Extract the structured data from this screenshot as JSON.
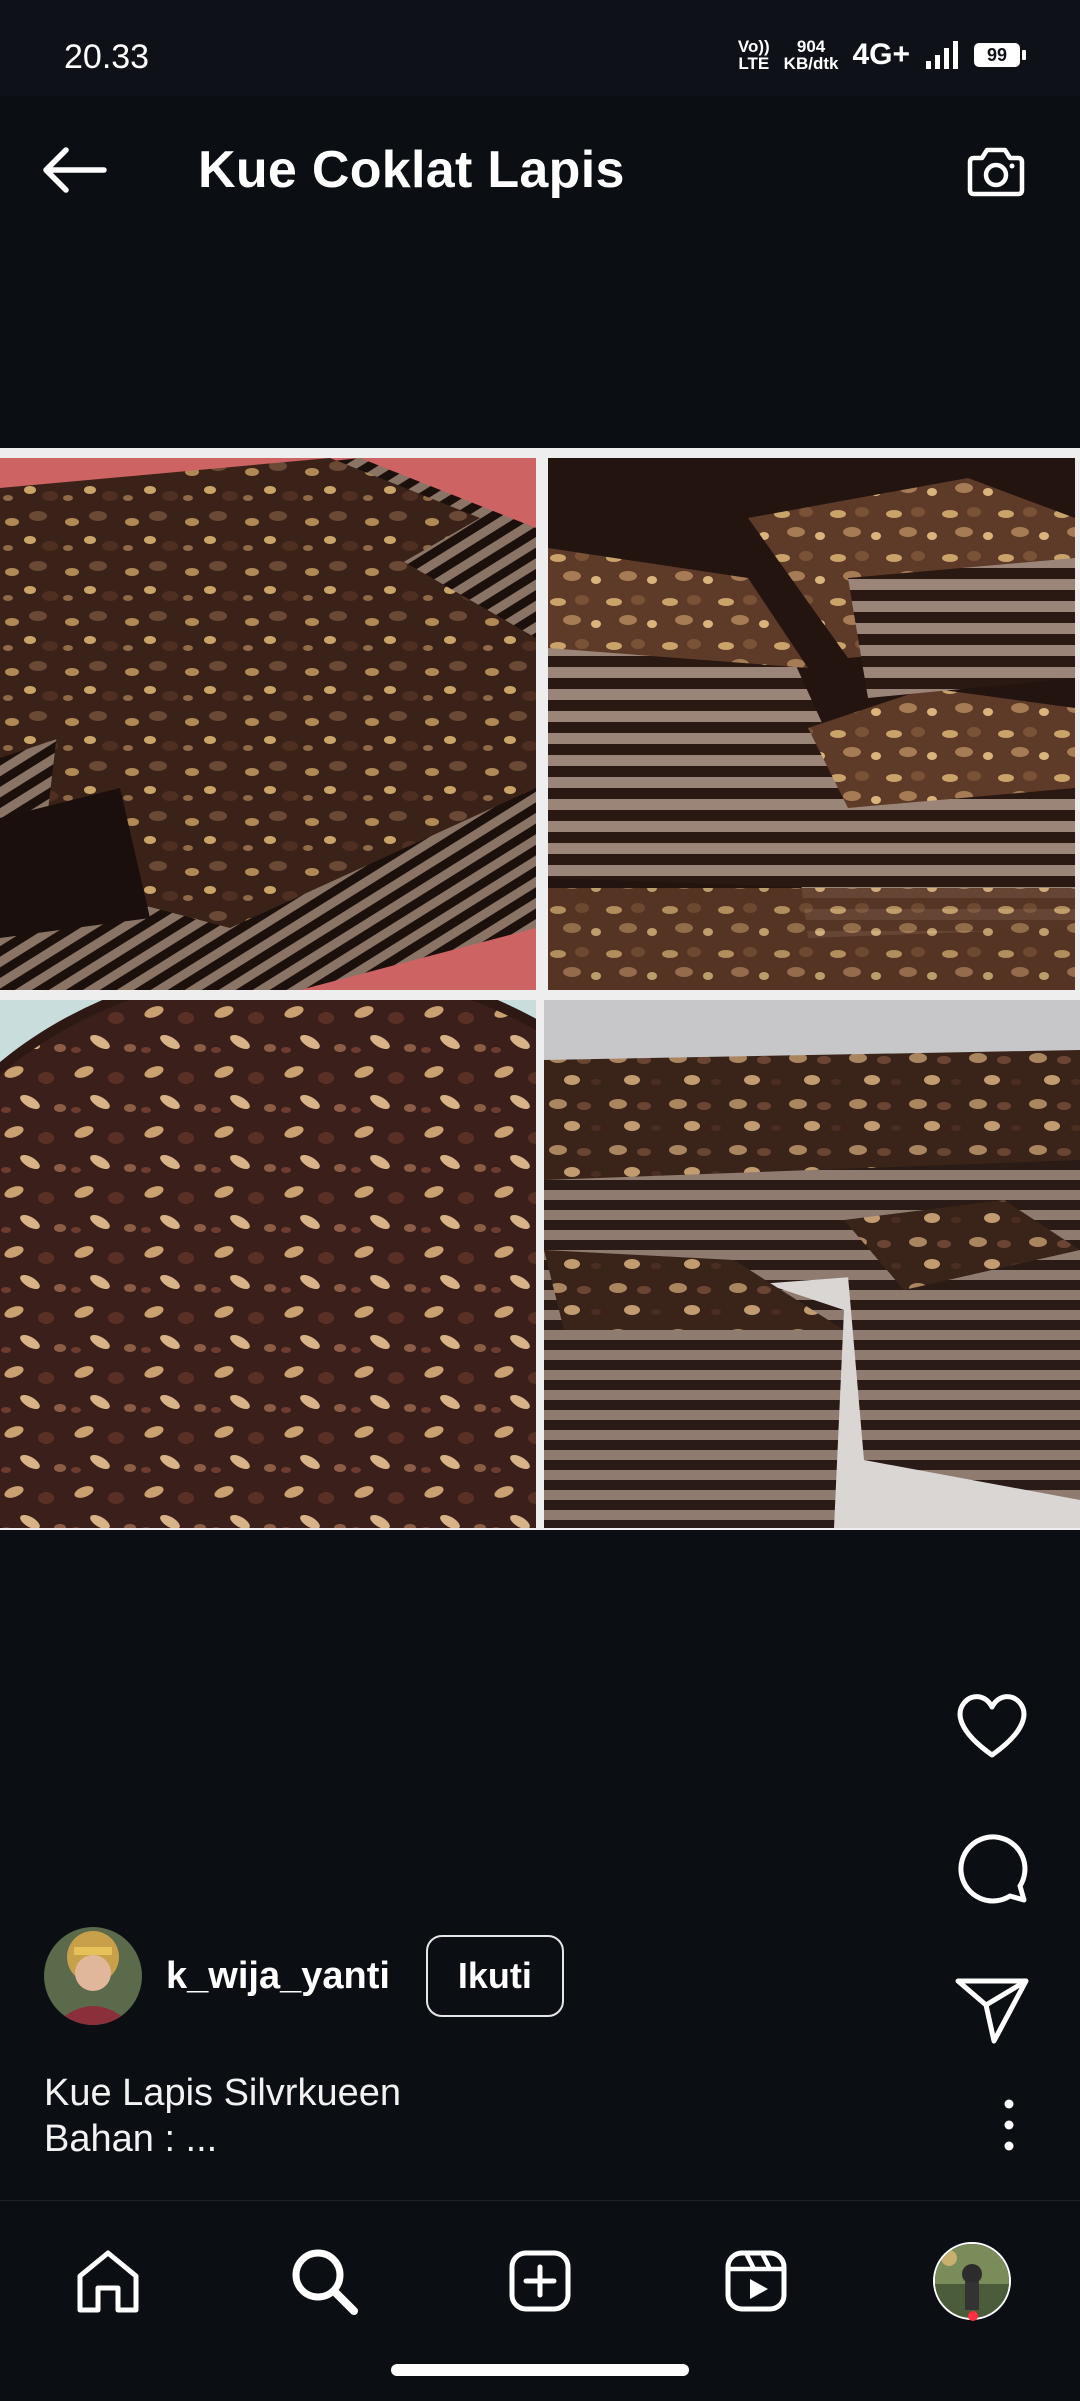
{
  "status_bar": {
    "time": "20.33",
    "volte_top": "Vo))",
    "volte_bottom": "LTE",
    "speed_value": "904",
    "speed_unit": "KB/dtk",
    "network": "4G+",
    "battery": "99"
  },
  "header": {
    "title": "Kue Coklat Lapis",
    "back_icon": "arrow-left-icon",
    "camera_icon": "camera-icon"
  },
  "post": {
    "username": "k_wija_yanti",
    "follow_label": "Ikuti",
    "caption_line1": "Kue Lapis Silvrkueen",
    "caption_line2": "Bahan : ..."
  },
  "actions": [
    "heart-icon",
    "comment-icon",
    "share-icon",
    "more-vertical-icon"
  ],
  "bottom_nav": [
    "home-icon",
    "search-icon",
    "create-icon",
    "reels-icon",
    "profile-avatar"
  ],
  "colors": {
    "background": "#0b0e13",
    "text": "#ffffff",
    "notification": "#ff3040"
  }
}
